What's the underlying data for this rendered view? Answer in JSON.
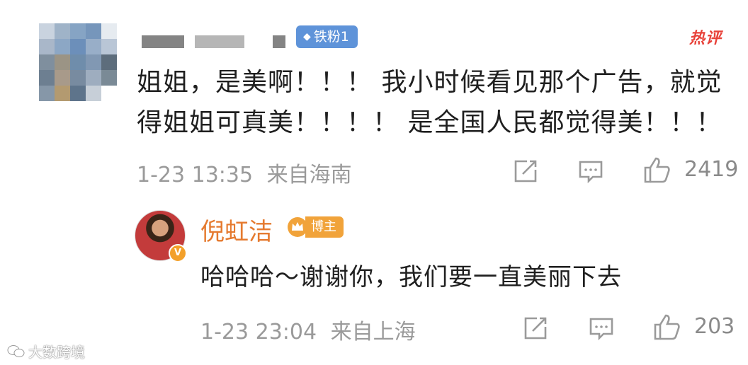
{
  "comment": {
    "badge_fan": "铁粉1",
    "hot_label": "热评",
    "text": "姐姐，是美啊！！！ 我小时候看见那个广告，就觉得姐姐可真美！！！！ 是全国人民都觉得美！！！",
    "time": "1-23 13:35",
    "location": "来自海南",
    "likes": "2419"
  },
  "reply": {
    "name": "倪虹洁",
    "badge_host": "博主",
    "text": "哈哈哈～谢谢你，我们要一直美丽下去",
    "time": "1-23 23:04",
    "location": "来自上海",
    "likes": "203"
  },
  "watermark": "大数跨境",
  "colors": {
    "fan_badge": "#5e93d9",
    "hot": "#e8423a",
    "author_name": "#e57a2f",
    "host_badge": "#f1a33a",
    "meta_gray": "#9a9a9a"
  },
  "icons": [
    "share-icon",
    "comment-icon",
    "like-icon",
    "crown-icon",
    "verified-icon",
    "wechat-icon"
  ]
}
